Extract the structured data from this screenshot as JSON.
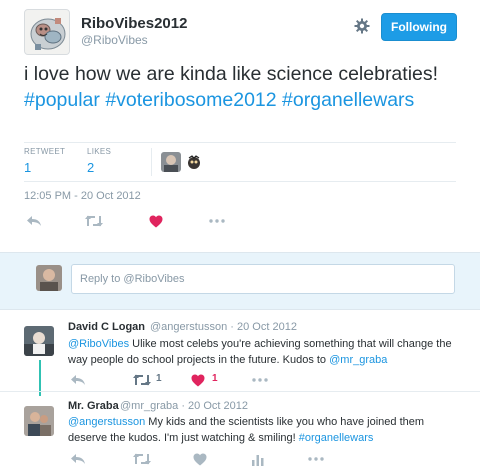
{
  "tweet": {
    "author_name": "RiboVibes2012",
    "author_handle": "@RiboVibes",
    "follow_label": "Following",
    "text_plain": "i love how we are kinda like science celebraties! ",
    "hashtags": [
      "#popular",
      "#voteribosome2012",
      "#organellewars"
    ],
    "stats": {
      "retweets_label": "RETWEET",
      "retweets_count": "1",
      "likes_label": "LIKES",
      "likes_count": "2"
    },
    "timestamp": "12:05 PM - 20 Oct 2012",
    "icons": [
      "reply-icon",
      "retweet-icon",
      "heart-icon",
      "more-icon",
      "gear-icon"
    ],
    "colors": {
      "accent": "#1b95e0",
      "follow_button": "#1d9ce6",
      "heart": "#e0245e",
      "retweet_active": "#17bf63"
    }
  },
  "reply_box": {
    "placeholder": "Reply to @RiboVibes"
  },
  "replies": [
    {
      "name": "David C Logan",
      "handle": "@angerstusson",
      "sep": "·",
      "date": "20 Oct 2012",
      "mention": "@RiboVibes",
      "text_1": " Ulike most celebs you're achieving something that will change the way people do school projects in the future. Kudos to ",
      "mention_2": "@mr_graba",
      "retweet_count": "1",
      "like_count": "1"
    },
    {
      "name": "Mr. Graba",
      "handle": "@mr_graba",
      "sep": "·",
      "date": "20 Oct 2012",
      "mention": "@angerstusson",
      "text_1": "  My kids and the scientists like you who have joined them deserve the kudos.  I'm just watching & smiling! ",
      "hashtag": "#organellewars"
    }
  ]
}
